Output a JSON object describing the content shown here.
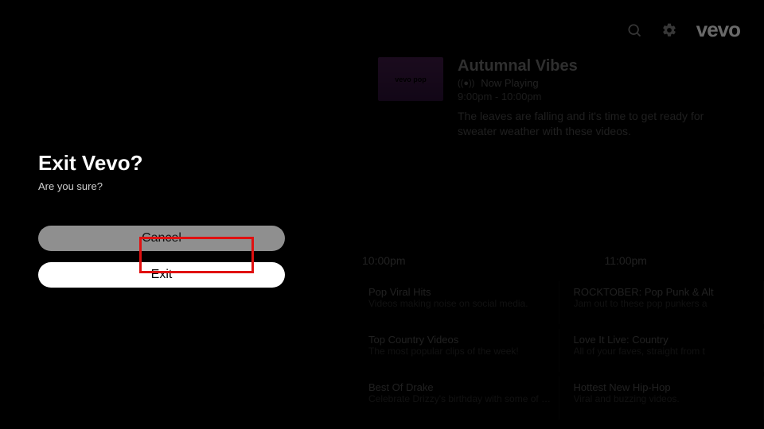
{
  "header": {
    "logo_text": "vevo"
  },
  "nowplaying": {
    "thumb_label": "vevo pop",
    "title": "Autumnal Vibes",
    "status": "Now Playing",
    "time_range": "9:00pm - 10:00pm",
    "description": "The leaves are falling and it's time to get ready for sweater weather with these videos."
  },
  "guide": {
    "time_headers": [
      "10:00pm",
      "11:00pm"
    ],
    "rows": [
      {
        "cells": [
          {
            "title": "Pop Viral Hits",
            "sub": "Videos making noise on social media."
          },
          {
            "title": "ROCKTOBER: Pop Punk & Alt",
            "sub": "Jam out to these pop punkers a"
          }
        ]
      },
      {
        "cells": [
          {
            "title": "Top Country Videos",
            "sub": "The most popular clips of the week!"
          },
          {
            "title": "Love It Live: Country",
            "sub": "All of your faves, straight from t"
          }
        ]
      },
      {
        "cells": [
          {
            "title": "Best Of Drake",
            "sub": "Celebrate Drizzy's birthday with some of his best videos."
          },
          {
            "title": "Hottest New Hip-Hop",
            "sub": "Viral and buzzing videos."
          }
        ]
      }
    ]
  },
  "dialog": {
    "title": "Exit Vevo?",
    "subtitle": "Are you sure?",
    "cancel_label": "Cancel",
    "exit_label": "Exit"
  }
}
